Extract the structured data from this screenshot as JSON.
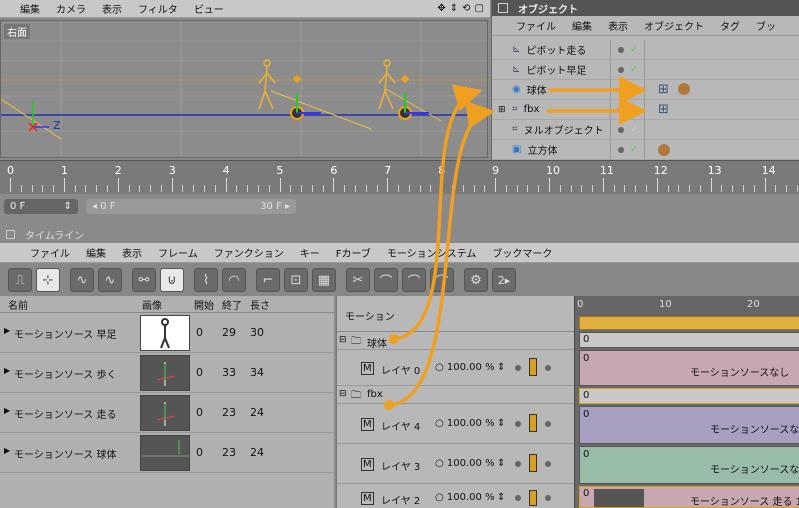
{
  "viewport": {
    "menu": [
      "編集",
      "カメラ",
      "表示",
      "フィルタ",
      "ビュー"
    ],
    "label": "右面",
    "axis_z": "Z"
  },
  "object_manager": {
    "title": "オブジェクト",
    "menu": [
      "ファイル",
      "編集",
      "表示",
      "オブジェクト",
      "タグ",
      "ブッ"
    ],
    "objects": [
      {
        "name": "ピボット走る",
        "icon": "pivot-icon"
      },
      {
        "name": "ピボット早足",
        "icon": "pivot-icon"
      },
      {
        "name": "球体",
        "icon": "sphere-icon"
      },
      {
        "name": "fbx",
        "icon": "null-icon"
      },
      {
        "name": "ヌルオブジェクト",
        "icon": "null-icon"
      },
      {
        "name": "立方体",
        "icon": "cube-icon"
      }
    ]
  },
  "ruler": {
    "ticks": [
      "0",
      "1",
      "2",
      "3",
      "4",
      "5",
      "6",
      "7",
      "8",
      "9",
      "10",
      "11",
      "12",
      "13",
      "14"
    ]
  },
  "framebar": {
    "current": "0 F",
    "start": "0 F",
    "end": "30 F"
  },
  "timeline": {
    "title": "タイムライン",
    "menu": [
      "ファイル",
      "編集",
      "表示",
      "フレーム",
      "ファンクション",
      "キー",
      "Fカーブ",
      "モーションシステム",
      "ブックマーク"
    ],
    "headers": {
      "name": "名前",
      "image": "画像",
      "start": "開始",
      "end": "終了",
      "length": "長さ",
      "motion": "モーション"
    },
    "sources": [
      {
        "name": "モーションソース 早足",
        "start": "0",
        "end": "29",
        "length": "30"
      },
      {
        "name": "モーションソース 歩く",
        "start": "0",
        "end": "33",
        "length": "34"
      },
      {
        "name": "モーションソース 走る",
        "start": "0",
        "end": "23",
        "length": "24"
      },
      {
        "name": "モーションソース 球体",
        "start": "0",
        "end": "23",
        "length": "24"
      }
    ],
    "layers": [
      {
        "name": "球体",
        "kind": "group"
      },
      {
        "name": "レイヤ 0",
        "kind": "layer",
        "pct": "○ 100.00 %"
      },
      {
        "name": "fbx",
        "kind": "group"
      },
      {
        "name": "レイヤ 4",
        "kind": "layer",
        "pct": "○ 100.00 %"
      },
      {
        "name": "レイヤ 3",
        "kind": "layer",
        "pct": "○ 100.00 %"
      },
      {
        "name": "レイヤ 2",
        "kind": "layer",
        "pct": "○ 100.00 %"
      }
    ],
    "track_ticks": [
      "0",
      "10",
      "20"
    ],
    "clips": [
      {
        "start": "0",
        "label": ""
      },
      {
        "start": "0",
        "label": "モーションソースなし"
      },
      {
        "start": "0",
        "label": ""
      },
      {
        "start": "0",
        "label": "モーションソースな"
      },
      {
        "start": "0",
        "label": "モーションソースな"
      },
      {
        "start": "0",
        "label": "モーションソース 走る 1"
      }
    ]
  },
  "colors": {
    "accent": "#f0a020",
    "clip_pink": "#c8a8b0",
    "clip_purple": "#a8a0c0",
    "clip_green": "#98bca8",
    "clip_orange": "#e8c070"
  }
}
